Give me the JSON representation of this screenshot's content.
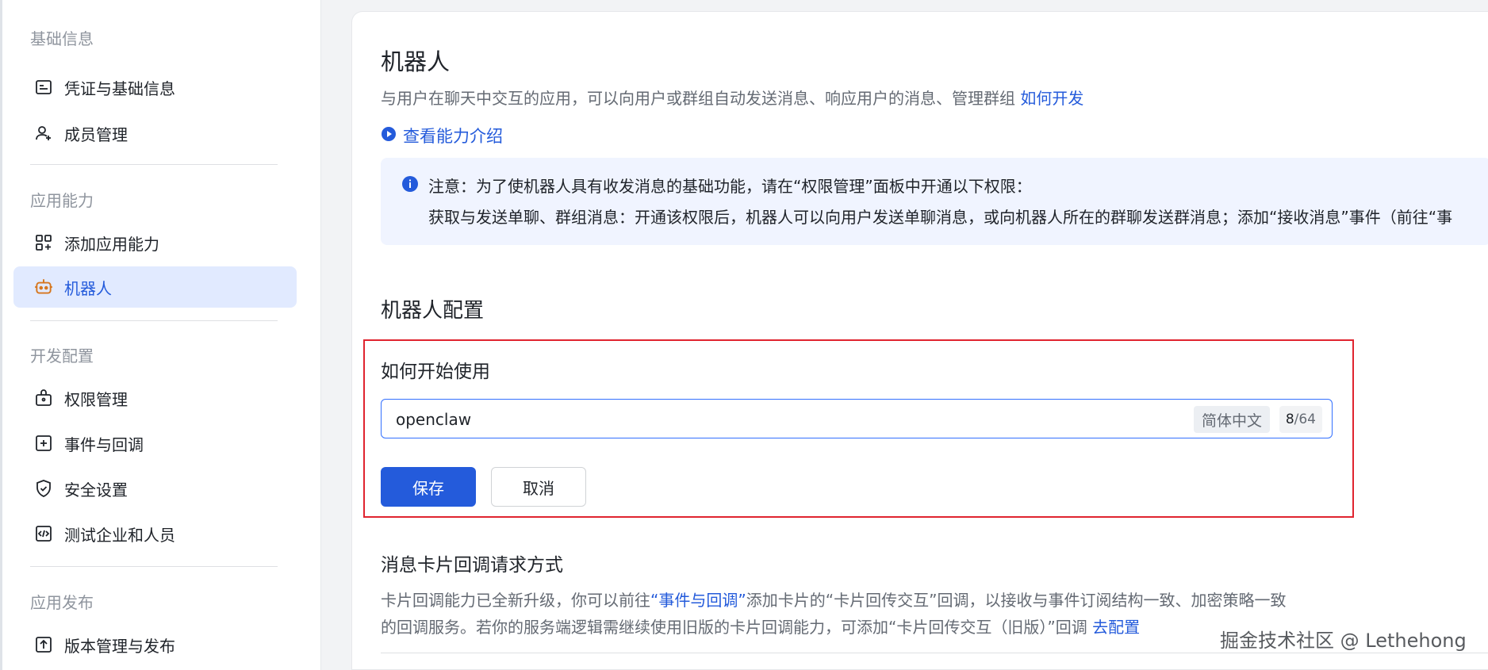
{
  "sidebar": {
    "groups": [
      {
        "title": "基础信息"
      },
      {
        "title": "应用能力"
      },
      {
        "title": "开发配置"
      },
      {
        "title": "应用发布"
      }
    ],
    "items": [
      {
        "label": "凭证与基础信息",
        "icon": "credential-icon"
      },
      {
        "label": "成员管理",
        "icon": "add-member-icon"
      },
      {
        "label": "添加应用能力",
        "icon": "add-capability-icon"
      },
      {
        "label": "机器人",
        "icon": "robot-icon",
        "active": true
      },
      {
        "label": "权限管理",
        "icon": "permission-icon"
      },
      {
        "label": "事件与回调",
        "icon": "event-icon"
      },
      {
        "label": "安全设置",
        "icon": "shield-icon"
      },
      {
        "label": "测试企业和人员",
        "icon": "code-icon"
      },
      {
        "label": "版本管理与发布",
        "icon": "upload-icon"
      }
    ]
  },
  "main": {
    "title": "机器人",
    "description": "与用户在聊天中交互的应用，可以向用户或群组自动发送消息、响应用户的消息、管理群组",
    "how_to_dev": "如何开发",
    "intro_link": "查看能力介绍",
    "notice": {
      "line1": "注意：为了使机器人具有收发消息的基础功能，请在“权限管理”面板中开通以下权限：",
      "line2": "获取与发送单聊、群组消息：开通该权限后，机器人可以向用户发送单聊消息，或向机器人所在的群聊发送群消息；添加“接收消息”事件（前往“事"
    },
    "config_title": "机器人配置",
    "how_to_use": {
      "title": "如何开始使用",
      "input_value": "openclaw",
      "lang": "简体中文",
      "count": "8",
      "max": "/64",
      "save_label": "保存",
      "cancel_label": "取消"
    },
    "card_callback": {
      "title": "消息卡片回调请求方式",
      "desc1_a": "卡片回调能力已全新升级，你可以前往",
      "desc1_link": "“事件与回调”",
      "desc1_b": "添加卡片的“卡片回传交互”回调，以接收与事件订阅结构一致、加密策略一致",
      "desc2_a": "的回调服务。若你的服务端逻辑需继续使用旧版的卡片回调能力，可添加“卡片回传交互（旧版）”回调 ",
      "desc2_link": "去配置"
    }
  },
  "watermark": "掘金技术社区 @ Lethehong",
  "colors": {
    "accent": "#245bdb",
    "active_bg": "#e1eaff",
    "highlight_border": "#e0242f",
    "notice_bg": "#f0f4ff"
  }
}
